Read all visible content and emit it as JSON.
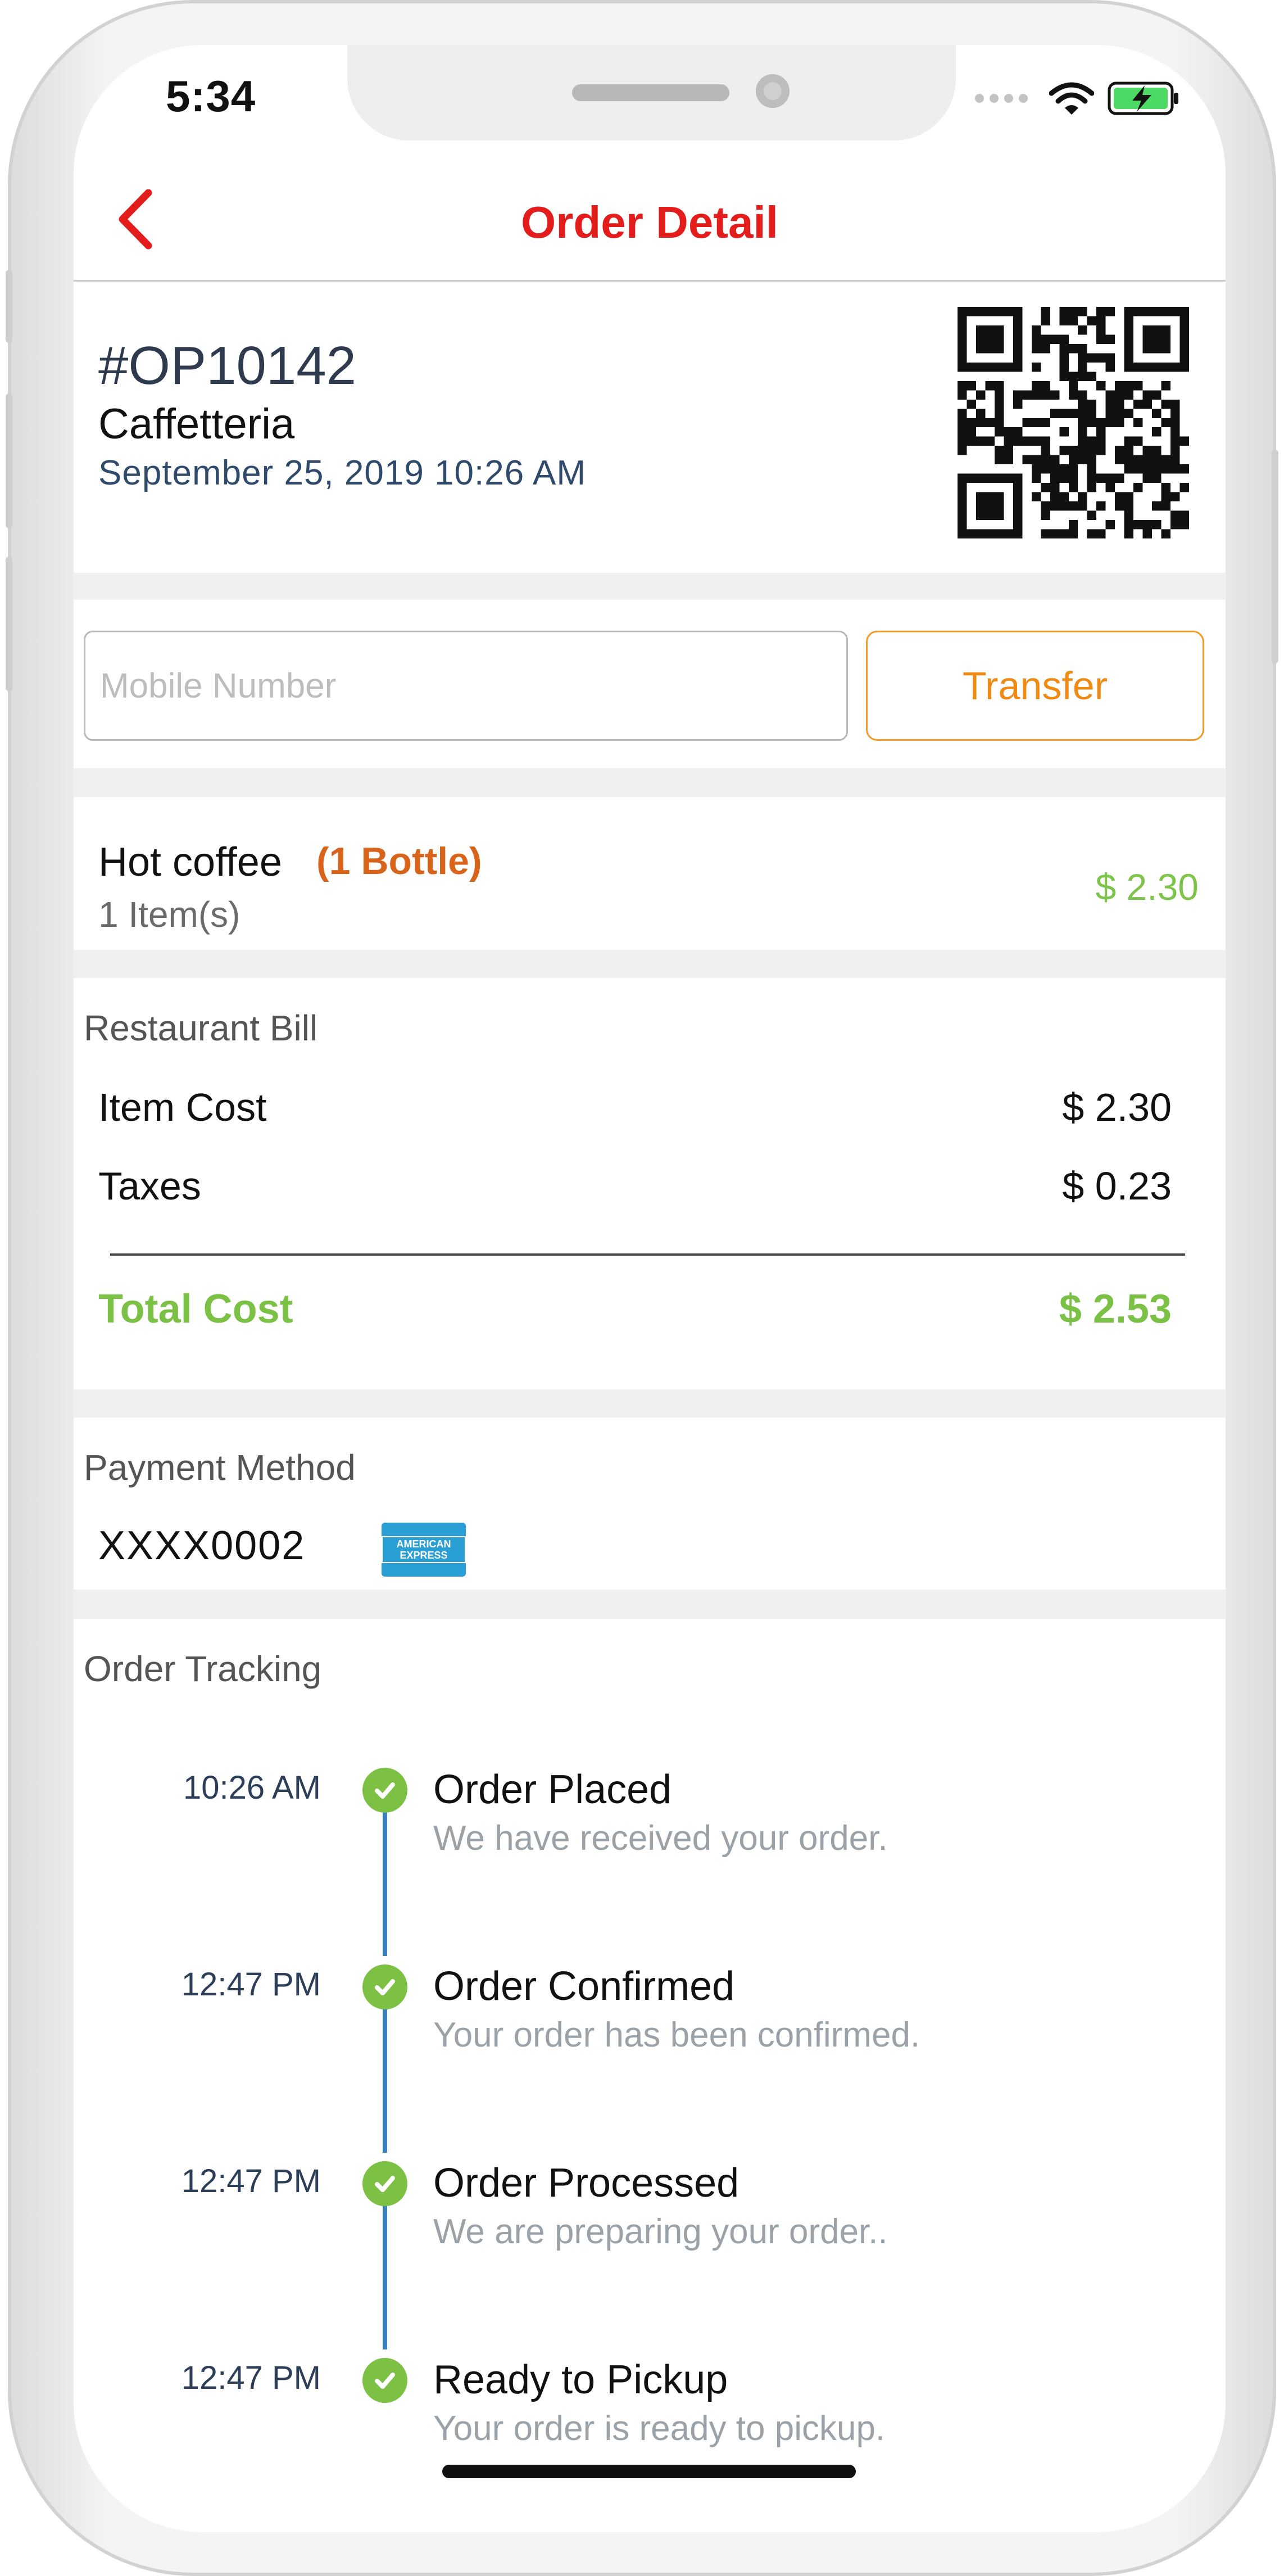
{
  "status": {
    "time": "5:34"
  },
  "nav": {
    "title": "Order Detail"
  },
  "order": {
    "id": "#OP10142",
    "venue": "Caffetteria",
    "datetime": "September 25, 2019 10:26 AM"
  },
  "transfer": {
    "placeholder": "Mobile Number",
    "button_label": "Transfer"
  },
  "item": {
    "name": "Hot coffee",
    "qty": "(1 Bottle)",
    "count": "1 Item(s)",
    "price": "$ 2.30"
  },
  "bill": {
    "label": "Restaurant Bill",
    "rows": [
      {
        "label": "Item Cost",
        "value": "$ 2.30"
      },
      {
        "label": "Taxes",
        "value": "$ 0.23"
      }
    ],
    "total": {
      "label": "Total Cost",
      "value": "$ 2.53"
    }
  },
  "payment": {
    "label": "Payment Method",
    "card": "XXXX0002",
    "card_brand": "AMERICAN EXPRESS"
  },
  "tracking": {
    "label": "Order Tracking",
    "steps": [
      {
        "time": "10:26 AM",
        "title": "Order Placed",
        "desc": "We have received your order."
      },
      {
        "time": "12:47 PM",
        "title": "Order Confirmed",
        "desc": "Your order has been confirmed."
      },
      {
        "time": "12:47 PM",
        "title": "Order Processed",
        "desc": "We are preparing your order.."
      },
      {
        "time": "12:47 PM",
        "title": "Ready to Pickup",
        "desc": "Your order is ready to pickup."
      }
    ]
  },
  "colors": {
    "accent_red": "#e31c1c",
    "transfer_orange": "#ef8a14",
    "price_green": "#7cc44a",
    "timeline_blue": "#3a82c4",
    "check_green": "#7cc144"
  }
}
